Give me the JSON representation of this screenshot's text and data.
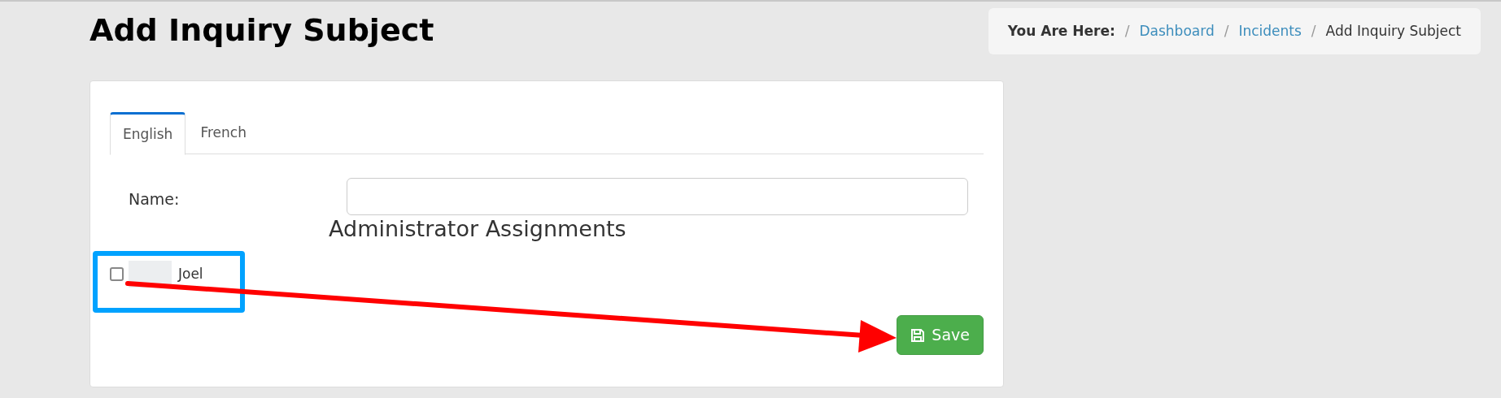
{
  "page_title": "Add Inquiry Subject",
  "breadcrumb": {
    "label": "You Are Here:",
    "items": [
      {
        "separator": "/",
        "text": "Dashboard",
        "kind": "link"
      },
      {
        "separator": "/",
        "text": "Incidents",
        "kind": "link"
      },
      {
        "separator": "/",
        "text": "Add Inquiry Subject",
        "kind": "current"
      }
    ]
  },
  "tabs": [
    {
      "label": "English",
      "selected": true
    },
    {
      "label": "French",
      "selected": false
    }
  ],
  "name_field": {
    "label": "Name:"
  },
  "section_title": "Administrator Assignments",
  "assignments": [
    {
      "name": "Joel",
      "checked": false
    }
  ],
  "save_button": "Save"
}
